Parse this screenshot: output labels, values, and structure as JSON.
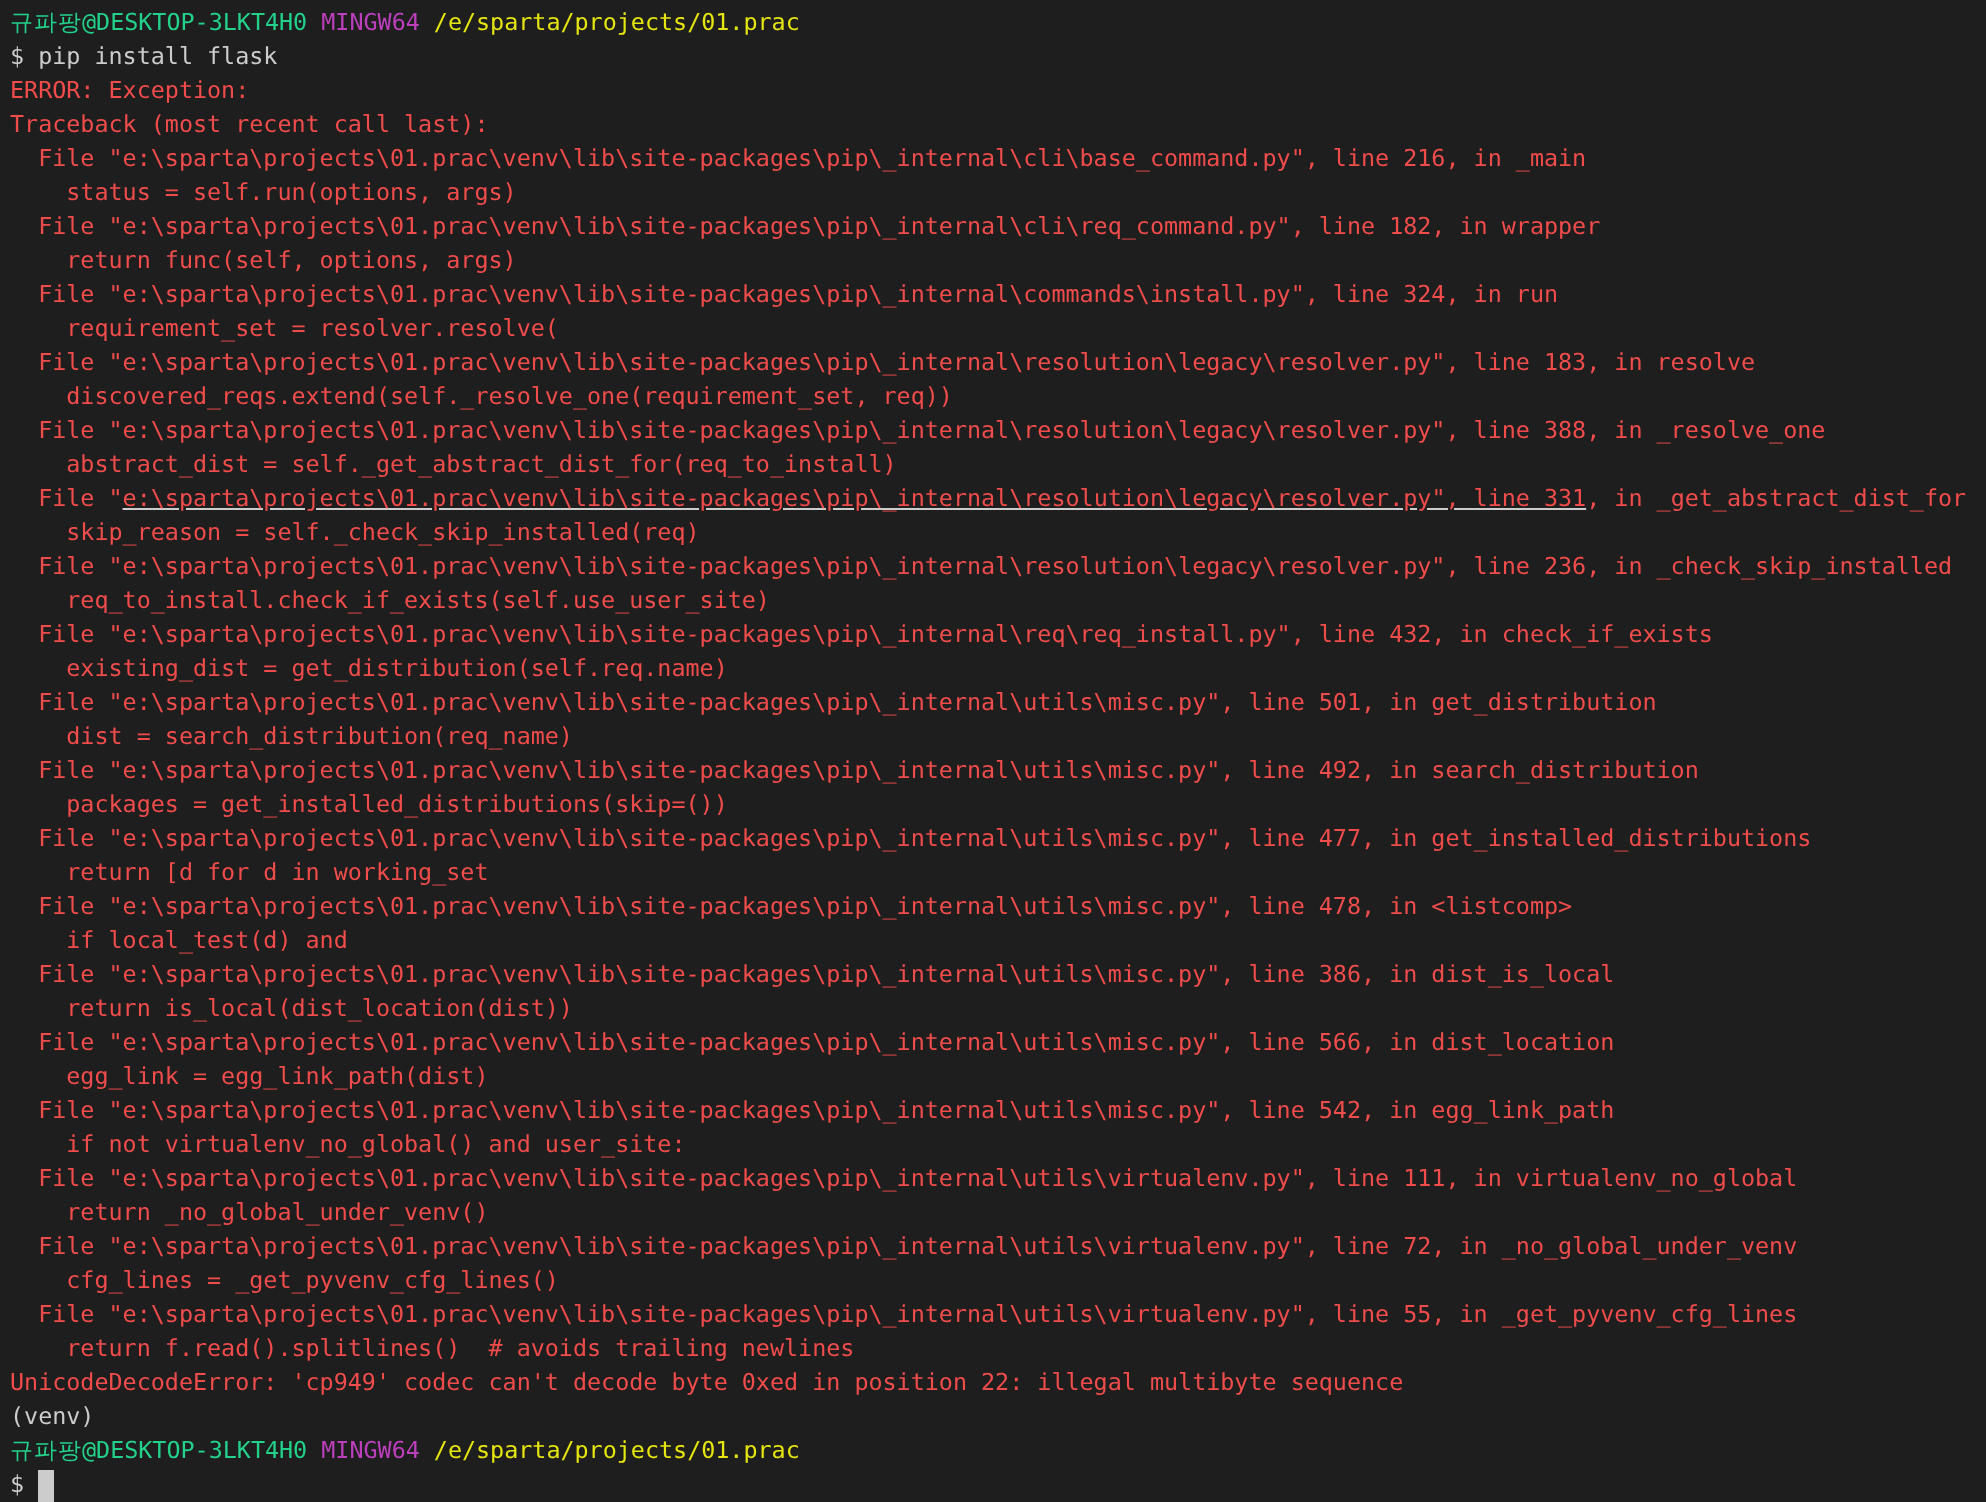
{
  "terminal": {
    "lines": [
      {
        "kind": "prompt",
        "user_host": "규파팡@DESKTOP-3LKT4H0",
        "shell": "MINGW64",
        "path": "/e/sparta/projects/01.prac"
      },
      {
        "kind": "command",
        "text": "$ pip install flask"
      },
      {
        "kind": "error",
        "text": "ERROR: Exception:"
      },
      {
        "kind": "error",
        "text": "Traceback (most recent call last):"
      },
      {
        "kind": "error",
        "text": "  File \"e:\\sparta\\projects\\01.prac\\venv\\lib\\site-packages\\pip\\_internal\\cli\\base_command.py\", line 216, in _main"
      },
      {
        "kind": "error",
        "text": "    status = self.run(options, args)"
      },
      {
        "kind": "error",
        "text": "  File \"e:\\sparta\\projects\\01.prac\\venv\\lib\\site-packages\\pip\\_internal\\cli\\req_command.py\", line 182, in wrapper"
      },
      {
        "kind": "error",
        "text": "    return func(self, options, args)"
      },
      {
        "kind": "error",
        "text": "  File \"e:\\sparta\\projects\\01.prac\\venv\\lib\\site-packages\\pip\\_internal\\commands\\install.py\", line 324, in run"
      },
      {
        "kind": "error",
        "text": "    requirement_set = resolver.resolve("
      },
      {
        "kind": "error",
        "text": "  File \"e:\\sparta\\projects\\01.prac\\venv\\lib\\site-packages\\pip\\_internal\\resolution\\legacy\\resolver.py\", line 183, in resolve"
      },
      {
        "kind": "error",
        "text": "    discovered_reqs.extend(self._resolve_one(requirement_set, req))"
      },
      {
        "kind": "error",
        "text": "  File \"e:\\sparta\\projects\\01.prac\\venv\\lib\\site-packages\\pip\\_internal\\resolution\\legacy\\resolver.py\", line 388, in _resolve_one"
      },
      {
        "kind": "error",
        "text": "    abstract_dist = self._get_abstract_dist_for(req_to_install)"
      },
      {
        "kind": "link",
        "before": "  File \"",
        "link": "e:\\sparta\\projects\\01.prac\\venv\\lib\\site-packages\\pip\\_internal\\resolution\\legacy\\resolver.py\", line 331",
        "after": ", in _get_abstract_dist_for"
      },
      {
        "kind": "error",
        "text": "    skip_reason = self._check_skip_installed(req)"
      },
      {
        "kind": "error",
        "text": "  File \"e:\\sparta\\projects\\01.prac\\venv\\lib\\site-packages\\pip\\_internal\\resolution\\legacy\\resolver.py\", line 236, in _check_skip_installed"
      },
      {
        "kind": "error",
        "text": "    req_to_install.check_if_exists(self.use_user_site)"
      },
      {
        "kind": "error",
        "text": "  File \"e:\\sparta\\projects\\01.prac\\venv\\lib\\site-packages\\pip\\_internal\\req\\req_install.py\", line 432, in check_if_exists"
      },
      {
        "kind": "error",
        "text": "    existing_dist = get_distribution(self.req.name)"
      },
      {
        "kind": "error",
        "text": "  File \"e:\\sparta\\projects\\01.prac\\venv\\lib\\site-packages\\pip\\_internal\\utils\\misc.py\", line 501, in get_distribution"
      },
      {
        "kind": "error",
        "text": "    dist = search_distribution(req_name)"
      },
      {
        "kind": "error",
        "text": "  File \"e:\\sparta\\projects\\01.prac\\venv\\lib\\site-packages\\pip\\_internal\\utils\\misc.py\", line 492, in search_distribution"
      },
      {
        "kind": "error",
        "text": "    packages = get_installed_distributions(skip=())"
      },
      {
        "kind": "error",
        "text": "  File \"e:\\sparta\\projects\\01.prac\\venv\\lib\\site-packages\\pip\\_internal\\utils\\misc.py\", line 477, in get_installed_distributions"
      },
      {
        "kind": "error",
        "text": "    return [d for d in working_set"
      },
      {
        "kind": "error",
        "text": "  File \"e:\\sparta\\projects\\01.prac\\venv\\lib\\site-packages\\pip\\_internal\\utils\\misc.py\", line 478, in <listcomp>"
      },
      {
        "kind": "error",
        "text": "    if local_test(d) and"
      },
      {
        "kind": "error",
        "text": "  File \"e:\\sparta\\projects\\01.prac\\venv\\lib\\site-packages\\pip\\_internal\\utils\\misc.py\", line 386, in dist_is_local"
      },
      {
        "kind": "error",
        "text": "    return is_local(dist_location(dist))"
      },
      {
        "kind": "error",
        "text": "  File \"e:\\sparta\\projects\\01.prac\\venv\\lib\\site-packages\\pip\\_internal\\utils\\misc.py\", line 566, in dist_location"
      },
      {
        "kind": "error",
        "text": "    egg_link = egg_link_path(dist)"
      },
      {
        "kind": "error",
        "text": "  File \"e:\\sparta\\projects\\01.prac\\venv\\lib\\site-packages\\pip\\_internal\\utils\\misc.py\", line 542, in egg_link_path"
      },
      {
        "kind": "error",
        "text": "    if not virtualenv_no_global() and user_site:"
      },
      {
        "kind": "error",
        "text": "  File \"e:\\sparta\\projects\\01.prac\\venv\\lib\\site-packages\\pip\\_internal\\utils\\virtualenv.py\", line 111, in virtualenv_no_global"
      },
      {
        "kind": "error",
        "text": "    return _no_global_under_venv()"
      },
      {
        "kind": "error",
        "text": "  File \"e:\\sparta\\projects\\01.prac\\venv\\lib\\site-packages\\pip\\_internal\\utils\\virtualenv.py\", line 72, in _no_global_under_venv"
      },
      {
        "kind": "error",
        "text": "    cfg_lines = _get_pyvenv_cfg_lines()"
      },
      {
        "kind": "error",
        "text": "  File \"e:\\sparta\\projects\\01.prac\\venv\\lib\\site-packages\\pip\\_internal\\utils\\virtualenv.py\", line 55, in _get_pyvenv_cfg_lines"
      },
      {
        "kind": "error",
        "text": "    return f.read().splitlines()  # avoids trailing newlines"
      },
      {
        "kind": "error",
        "text": "UnicodeDecodeError: 'cp949' codec can't decode byte 0xed in position 22: illegal multibyte sequence"
      },
      {
        "kind": "plain",
        "text": "(venv)"
      },
      {
        "kind": "prompt",
        "user_host": "규파팡@DESKTOP-3LKT4H0",
        "shell": "MINGW64",
        "path": "/e/sparta/projects/01.prac"
      },
      {
        "kind": "input",
        "text": "$"
      }
    ]
  }
}
